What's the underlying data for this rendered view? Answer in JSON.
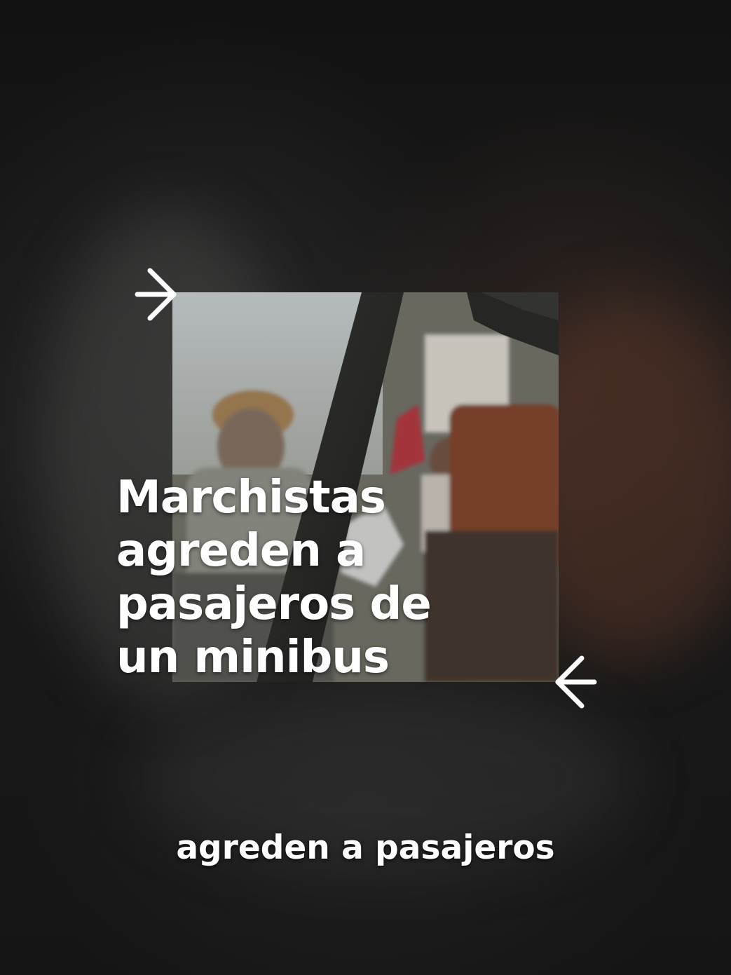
{
  "headline": {
    "line1": "Marchistas",
    "line2": "agreden a",
    "line3": "pasajeros de",
    "line4": "un minibus"
  },
  "caption": "agreden a pasajeros",
  "icons": {
    "top_arrow": "arrow-right-icon",
    "bottom_arrow": "arrow-left-icon"
  },
  "colors": {
    "text": "#ffffff",
    "background": "#121212"
  }
}
